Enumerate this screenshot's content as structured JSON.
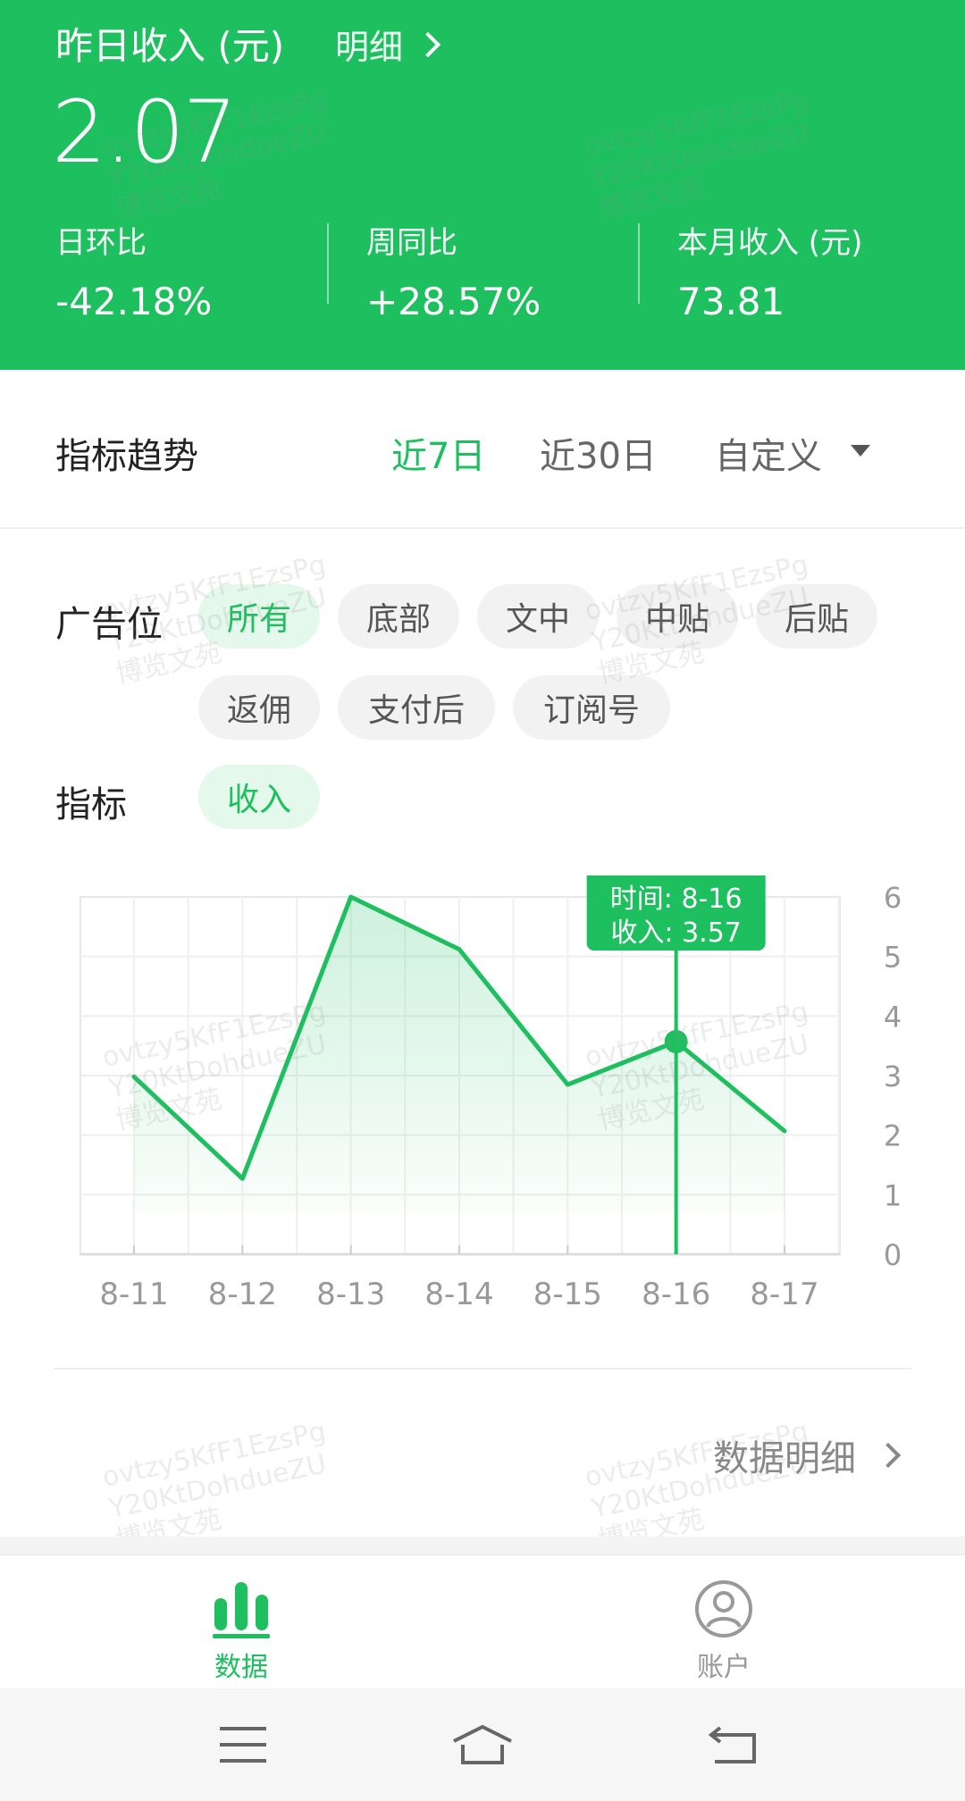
{
  "header": {
    "title": "昨日收入 (元)",
    "detail_link": "明细",
    "amount": "2.07",
    "stats": [
      {
        "label": "日环比",
        "value": "-42.18%"
      },
      {
        "label": "周同比",
        "value": "+28.57%"
      },
      {
        "label": "本月收入 (元)",
        "value": "73.81"
      }
    ]
  },
  "trend": {
    "title": "指标趋势",
    "ranges": [
      "近7日",
      "近30日",
      "自定义"
    ],
    "active_range": "近7日"
  },
  "filters": {
    "ad_position_label": "广告位",
    "ad_positions": [
      "所有",
      "底部",
      "文中",
      "中贴",
      "后贴",
      "返佣",
      "支付后",
      "订阅号"
    ],
    "active_position": "所有",
    "metric_label": "指标",
    "metrics": [
      "收入"
    ],
    "active_metric": "收入"
  },
  "chart_data": {
    "type": "area",
    "x": [
      "8-11",
      "8-12",
      "8-13",
      "8-14",
      "8-15",
      "8-16",
      "8-17"
    ],
    "values": [
      2.98,
      1.27,
      6.0,
      5.12,
      2.85,
      3.57,
      2.07
    ],
    "y_ticks": [
      "0",
      "1",
      "2",
      "3",
      "4",
      "5",
      "6"
    ],
    "ylim": [
      0,
      6
    ],
    "grid": true,
    "y_axis_side": "right",
    "tooltip": {
      "index": 5,
      "time_line": "时间: 8-16",
      "value_line": "收入: 3.57"
    },
    "color": "#1dbf5f"
  },
  "data_detail_link": "数据明细",
  "tabbar": {
    "items": [
      {
        "label": "数据",
        "icon": "bar-chart-icon",
        "active": true
      },
      {
        "label": "账户",
        "icon": "user-circle-icon",
        "active": false
      }
    ]
  },
  "watermark": {
    "line1": "ovtzy5KfF1EzsPg",
    "line2": "Y20KtDohdueZU",
    "line3": "博览文苑"
  },
  "colors": {
    "brand": "#1dbf5f",
    "chip_active_bg": "#e4f8ec",
    "chip_bg": "#f2f2f2"
  }
}
